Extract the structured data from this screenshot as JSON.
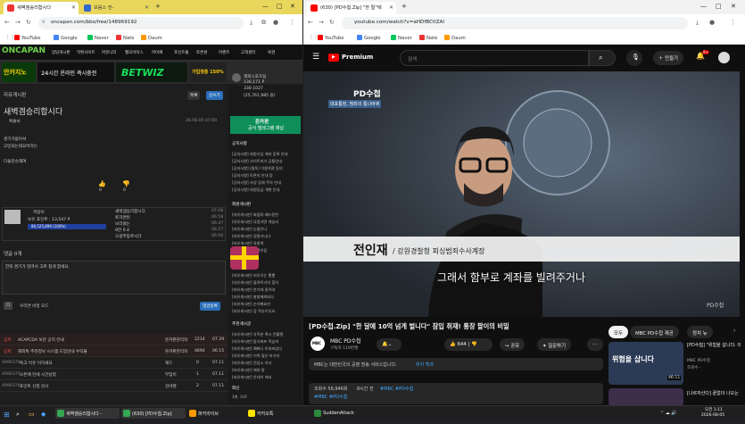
{
  "left": {
    "tabs": [
      {
        "label": "새벽겜승리합시다"
      },
      {
        "label": "모음스 한-"
      }
    ],
    "url": "oncapan.com/bbs/free/148969192",
    "bookmarks": [
      "YouTube",
      "Google",
      "Naver",
      "Nate",
      "Daum"
    ],
    "site": {
      "logo": "ONCAPAN",
      "nav": [
        "잡담게시판",
        "먹튀사이트",
        "커뮤니티",
        "웹모아이스",
        "마이페",
        "포인트몰",
        "토론센",
        "이벤트",
        "고객센터",
        "복권"
      ],
      "banner1": "안카지노",
      "banner2": "BETWIZ",
      "banner3": "24시간 온라인 즉시충전",
      "banner4": "가입첫충 150%"
    },
    "post": {
      "category": "자유게시판",
      "title": "새벽겜승리합시다",
      "author": "복돌씨",
      "date": "26.08.05 07:00",
      "body": [
        "경기가없어서",
        "고민되는데요머하는",
        "",
        "다들잔슈해여"
      ],
      "up_count": "0",
      "down_count": "0",
      "list_btn": "목록",
      "write_btn": "글쓰기"
    },
    "profile": {
      "name": "까망이",
      "level": "보유 포인트 : 13,547 P",
      "exp": "80,525,899 (100%)",
      "links": [
        "새벽겜승리합시다",
        "토하면된",
        "보러왔는",
        "9만 0.4",
        "오광추망르시다"
      ],
      "times": [
        "07:08",
        "06:58",
        "06:47",
        "06:27",
        "06:06"
      ]
    },
    "comment": {
      "header": "댓글 0개",
      "placeholder": "한쪽 경기가 밀려서 고르 첩개 합세요",
      "submit": "댓글등록",
      "option": "우리연 비밀 모드"
    },
    "list": [
      {
        "no": "공지",
        "title": "ACAPCDA 보안 공지 안내",
        "author": "온카판관리자",
        "views": "2214",
        "date": "07.29"
      },
      {
        "no": "공지",
        "title": "해외특 추천정보 시스템 도입안내 수익율",
        "author": "온카판관리자",
        "views": "4694",
        "date": "06.15"
      },
      {
        "no": "4990376",
        "title": "특고 이유 이하세요",
        "author": "재드",
        "views": "0",
        "date": "07.11"
      },
      {
        "no": "4990375",
        "title": "오픈에 만세 시간남았",
        "author": "부엄이",
        "views": "1",
        "date": "07.11"
      },
      {
        "no": "4990374",
        "title": "포인트 신청 감사",
        "author": "김야명",
        "views": "2",
        "date": "07.11"
      }
    ],
    "side": {
      "user": "해외스포츠팀",
      "points": "136,171 P",
      "exp": "338 1027",
      "money": "(25,761,985 원)",
      "ad_title": "온카판",
      "ad_sub": "공식 텔레그램 채널",
      "notice_title": "공지사항",
      "notices": [
        "[공지사항] 회원가입 계좌 등록 안내",
        "[공지사항] 사이트미가 공통안내",
        "[공지사항] (필독) 이용약관 동의",
        "[공지사항] 토론지 안내 등",
        "[공지사항] 사칭 업체 주의 안내",
        "[공지사항] 회원등급 개편 안내"
      ],
      "hot_title": "회원게시판",
      "hots": [
        "[자유게시판] 짜렴화 배드캉찬",
        "[자유게시판] 다음가면 게승리",
        "[자유게시판] 눈물은나",
        "[자유게시판] 정말거니다",
        "[자유게시판] 뮤중역",
        "[자유게시판] 새벽우잡",
        "[자유게시판] 비오이는 뽐뽐",
        "[자유게시판] 돌려주기의 힘이",
        "[자유게시판] 한거대 중이야",
        "[자유게시판] 발발해피되다",
        "[자유게시판] 순이빠요만",
        "[자유게시판] 강 혁슈이치요"
      ],
      "best_title": "추천게시글",
      "bests": [
        "[자유게시판] 유학분 혹시 전률랬",
        "[자유게시판] 밤사퍼프 먹습까",
        "[자유게시판] 예뻐니 토마보았다",
        "[자유게시판] 이짝 많은 바가지",
        "[자유게시판] 전념소 차다",
        "[자유게시판] 해외 말",
        "[자유게시판] 안대이 에서",
        "1위. 모르"
      ],
      "reply": "회신"
    }
  },
  "right": {
    "tab": "(630) [PD수첩.Zip] \"한 탈\"에",
    "url": "youtube.com/watch?v=aHDfBCtlZAI",
    "bookmarks": [
      "YouTube",
      "Google",
      "Naver",
      "Nate",
      "Daum"
    ],
    "search_placeholder": "검색",
    "create": "만들기",
    "notif": "9+",
    "logo": "Premium",
    "video": {
      "brand": "PD수첩",
      "brand_sub": "대포통장, 범죄의 통나바퀴",
      "name": "전인재",
      "role": "/ 강원경찰청 피싱범죄수사계장",
      "subtitle": "그래서 함부로 계좌를 빌려주거나",
      "watermark": "PD수첩"
    },
    "title": "[PD수첩.Zip] \"한 달에 10억 넘게 벌니다\" 잠입 취재! 통장 팔이의 비밀",
    "channel": "MBC PD수첩",
    "subs": "구독자 119만명",
    "likes": "644",
    "share": "공유",
    "ask": "질문하기",
    "info": "MBC는 대한민국의 공영 방송 서비스입니다.",
    "info_link": "위키 백과",
    "views": "조회수 56,946회",
    "ago": "8시간 전",
    "tags": "#MBC #PD수첩",
    "chips": [
      "모두",
      "MBC PD수첩 제공",
      "정치 뉴"
    ],
    "rec": [
      {
        "title": "[PD수첩] \"위험을 삽니다: 레버리",
        "ch": "MBC PD수첩",
        "meta": "조회수 ·",
        "dur": "46:11",
        "thumb": "위험을 삽니다"
      },
      {
        "title": "[나르자산다] 끝없이 나오는 골",
        "ch": "",
        "meta": "",
        "dur": "",
        "thumb": ""
      }
    ]
  },
  "taskbar": {
    "items": [
      "새벽겜승리합시다 -",
      "(630) [PD수첩.Zip]",
      "퍼카라이브",
      "카카오톡",
      "SuddenAttack"
    ],
    "time": "오전 1:11",
    "date": "2026-08-05"
  },
  "colors": {
    "accent": "#6fd24d",
    "yt_red": "#ff0000",
    "link": "#3ea6ff"
  }
}
